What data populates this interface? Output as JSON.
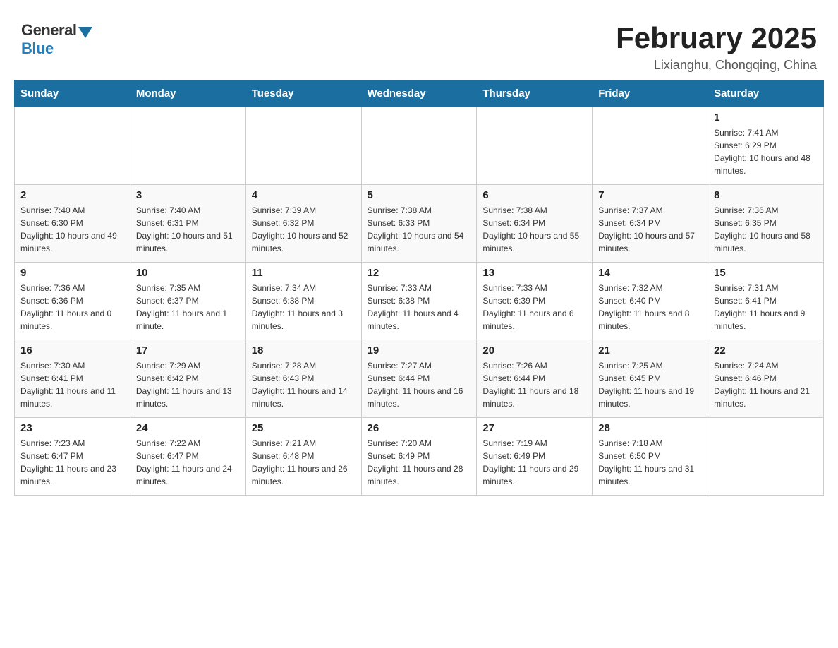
{
  "header": {
    "logo_general": "General",
    "logo_blue": "Blue",
    "month_title": "February 2025",
    "location": "Lixianghu, Chongqing, China"
  },
  "days_of_week": [
    "Sunday",
    "Monday",
    "Tuesday",
    "Wednesday",
    "Thursday",
    "Friday",
    "Saturday"
  ],
  "weeks": [
    [
      {
        "day": "",
        "sunrise": "",
        "sunset": "",
        "daylight": ""
      },
      {
        "day": "",
        "sunrise": "",
        "sunset": "",
        "daylight": ""
      },
      {
        "day": "",
        "sunrise": "",
        "sunset": "",
        "daylight": ""
      },
      {
        "day": "",
        "sunrise": "",
        "sunset": "",
        "daylight": ""
      },
      {
        "day": "",
        "sunrise": "",
        "sunset": "",
        "daylight": ""
      },
      {
        "day": "",
        "sunrise": "",
        "sunset": "",
        "daylight": ""
      },
      {
        "day": "1",
        "sunrise": "Sunrise: 7:41 AM",
        "sunset": "Sunset: 6:29 PM",
        "daylight": "Daylight: 10 hours and 48 minutes."
      }
    ],
    [
      {
        "day": "2",
        "sunrise": "Sunrise: 7:40 AM",
        "sunset": "Sunset: 6:30 PM",
        "daylight": "Daylight: 10 hours and 49 minutes."
      },
      {
        "day": "3",
        "sunrise": "Sunrise: 7:40 AM",
        "sunset": "Sunset: 6:31 PM",
        "daylight": "Daylight: 10 hours and 51 minutes."
      },
      {
        "day": "4",
        "sunrise": "Sunrise: 7:39 AM",
        "sunset": "Sunset: 6:32 PM",
        "daylight": "Daylight: 10 hours and 52 minutes."
      },
      {
        "day": "5",
        "sunrise": "Sunrise: 7:38 AM",
        "sunset": "Sunset: 6:33 PM",
        "daylight": "Daylight: 10 hours and 54 minutes."
      },
      {
        "day": "6",
        "sunrise": "Sunrise: 7:38 AM",
        "sunset": "Sunset: 6:34 PM",
        "daylight": "Daylight: 10 hours and 55 minutes."
      },
      {
        "day": "7",
        "sunrise": "Sunrise: 7:37 AM",
        "sunset": "Sunset: 6:34 PM",
        "daylight": "Daylight: 10 hours and 57 minutes."
      },
      {
        "day": "8",
        "sunrise": "Sunrise: 7:36 AM",
        "sunset": "Sunset: 6:35 PM",
        "daylight": "Daylight: 10 hours and 58 minutes."
      }
    ],
    [
      {
        "day": "9",
        "sunrise": "Sunrise: 7:36 AM",
        "sunset": "Sunset: 6:36 PM",
        "daylight": "Daylight: 11 hours and 0 minutes."
      },
      {
        "day": "10",
        "sunrise": "Sunrise: 7:35 AM",
        "sunset": "Sunset: 6:37 PM",
        "daylight": "Daylight: 11 hours and 1 minute."
      },
      {
        "day": "11",
        "sunrise": "Sunrise: 7:34 AM",
        "sunset": "Sunset: 6:38 PM",
        "daylight": "Daylight: 11 hours and 3 minutes."
      },
      {
        "day": "12",
        "sunrise": "Sunrise: 7:33 AM",
        "sunset": "Sunset: 6:38 PM",
        "daylight": "Daylight: 11 hours and 4 minutes."
      },
      {
        "day": "13",
        "sunrise": "Sunrise: 7:33 AM",
        "sunset": "Sunset: 6:39 PM",
        "daylight": "Daylight: 11 hours and 6 minutes."
      },
      {
        "day": "14",
        "sunrise": "Sunrise: 7:32 AM",
        "sunset": "Sunset: 6:40 PM",
        "daylight": "Daylight: 11 hours and 8 minutes."
      },
      {
        "day": "15",
        "sunrise": "Sunrise: 7:31 AM",
        "sunset": "Sunset: 6:41 PM",
        "daylight": "Daylight: 11 hours and 9 minutes."
      }
    ],
    [
      {
        "day": "16",
        "sunrise": "Sunrise: 7:30 AM",
        "sunset": "Sunset: 6:41 PM",
        "daylight": "Daylight: 11 hours and 11 minutes."
      },
      {
        "day": "17",
        "sunrise": "Sunrise: 7:29 AM",
        "sunset": "Sunset: 6:42 PM",
        "daylight": "Daylight: 11 hours and 13 minutes."
      },
      {
        "day": "18",
        "sunrise": "Sunrise: 7:28 AM",
        "sunset": "Sunset: 6:43 PM",
        "daylight": "Daylight: 11 hours and 14 minutes."
      },
      {
        "day": "19",
        "sunrise": "Sunrise: 7:27 AM",
        "sunset": "Sunset: 6:44 PM",
        "daylight": "Daylight: 11 hours and 16 minutes."
      },
      {
        "day": "20",
        "sunrise": "Sunrise: 7:26 AM",
        "sunset": "Sunset: 6:44 PM",
        "daylight": "Daylight: 11 hours and 18 minutes."
      },
      {
        "day": "21",
        "sunrise": "Sunrise: 7:25 AM",
        "sunset": "Sunset: 6:45 PM",
        "daylight": "Daylight: 11 hours and 19 minutes."
      },
      {
        "day": "22",
        "sunrise": "Sunrise: 7:24 AM",
        "sunset": "Sunset: 6:46 PM",
        "daylight": "Daylight: 11 hours and 21 minutes."
      }
    ],
    [
      {
        "day": "23",
        "sunrise": "Sunrise: 7:23 AM",
        "sunset": "Sunset: 6:47 PM",
        "daylight": "Daylight: 11 hours and 23 minutes."
      },
      {
        "day": "24",
        "sunrise": "Sunrise: 7:22 AM",
        "sunset": "Sunset: 6:47 PM",
        "daylight": "Daylight: 11 hours and 24 minutes."
      },
      {
        "day": "25",
        "sunrise": "Sunrise: 7:21 AM",
        "sunset": "Sunset: 6:48 PM",
        "daylight": "Daylight: 11 hours and 26 minutes."
      },
      {
        "day": "26",
        "sunrise": "Sunrise: 7:20 AM",
        "sunset": "Sunset: 6:49 PM",
        "daylight": "Daylight: 11 hours and 28 minutes."
      },
      {
        "day": "27",
        "sunrise": "Sunrise: 7:19 AM",
        "sunset": "Sunset: 6:49 PM",
        "daylight": "Daylight: 11 hours and 29 minutes."
      },
      {
        "day": "28",
        "sunrise": "Sunrise: 7:18 AM",
        "sunset": "Sunset: 6:50 PM",
        "daylight": "Daylight: 11 hours and 31 minutes."
      },
      {
        "day": "",
        "sunrise": "",
        "sunset": "",
        "daylight": ""
      }
    ]
  ]
}
